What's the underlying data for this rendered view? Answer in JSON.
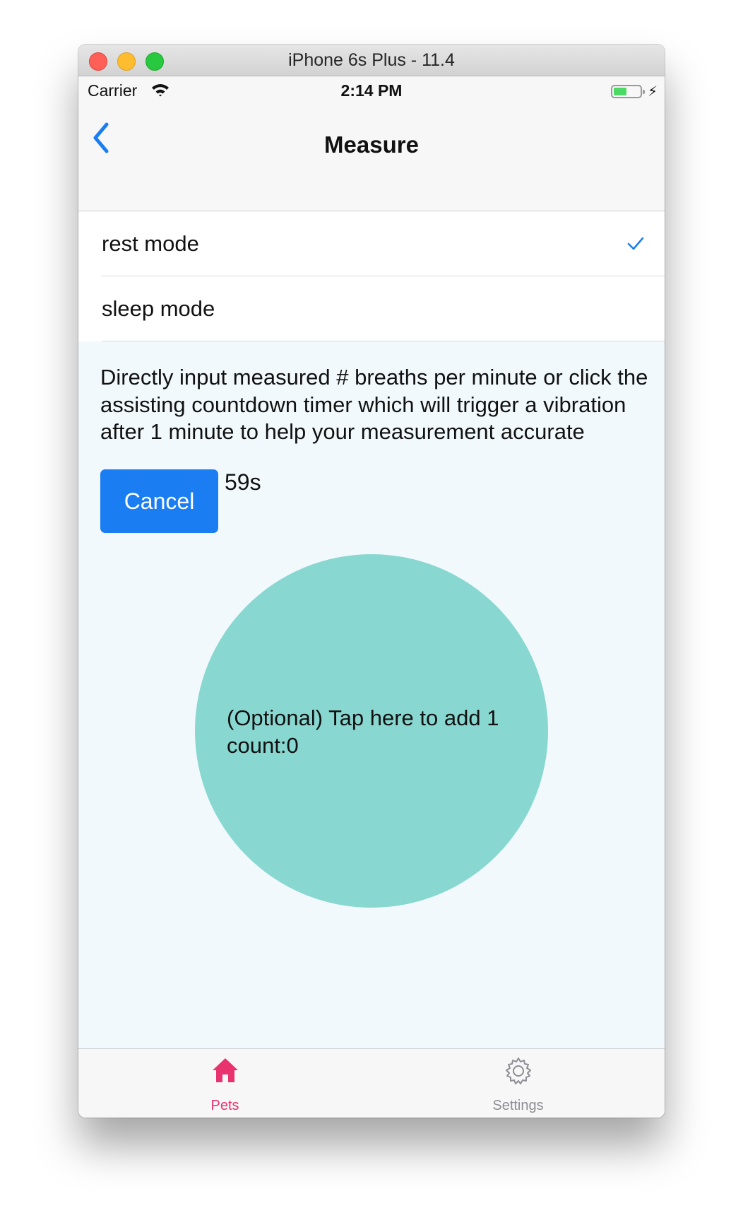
{
  "window": {
    "title": "iPhone 6s Plus - 11.4"
  },
  "status_bar": {
    "carrier": "Carrier",
    "time": "2:14 PM"
  },
  "nav": {
    "title": "Measure"
  },
  "modes": [
    {
      "label": "rest mode",
      "selected": true
    },
    {
      "label": "sleep mode",
      "selected": false
    }
  ],
  "description": "Directly input measured # breaths per minute or click the assisting countdown timer which will trigger a vibration after 1 minute to help your measurement accurate",
  "timer": {
    "button_label": "Cancel",
    "remaining": "59s"
  },
  "tap_circle": {
    "line1": "(Optional) Tap here to add 1",
    "line2": "count:0"
  },
  "tabs": [
    {
      "label": "Pets",
      "icon": "home-icon",
      "active": true
    },
    {
      "label": "Settings",
      "icon": "gear-icon",
      "active": false
    }
  ],
  "colors": {
    "accent": "#1a7ef2",
    "circle": "#88d8d1",
    "tab_active": "#e8336f",
    "tab_inactive": "#8e8e93"
  }
}
